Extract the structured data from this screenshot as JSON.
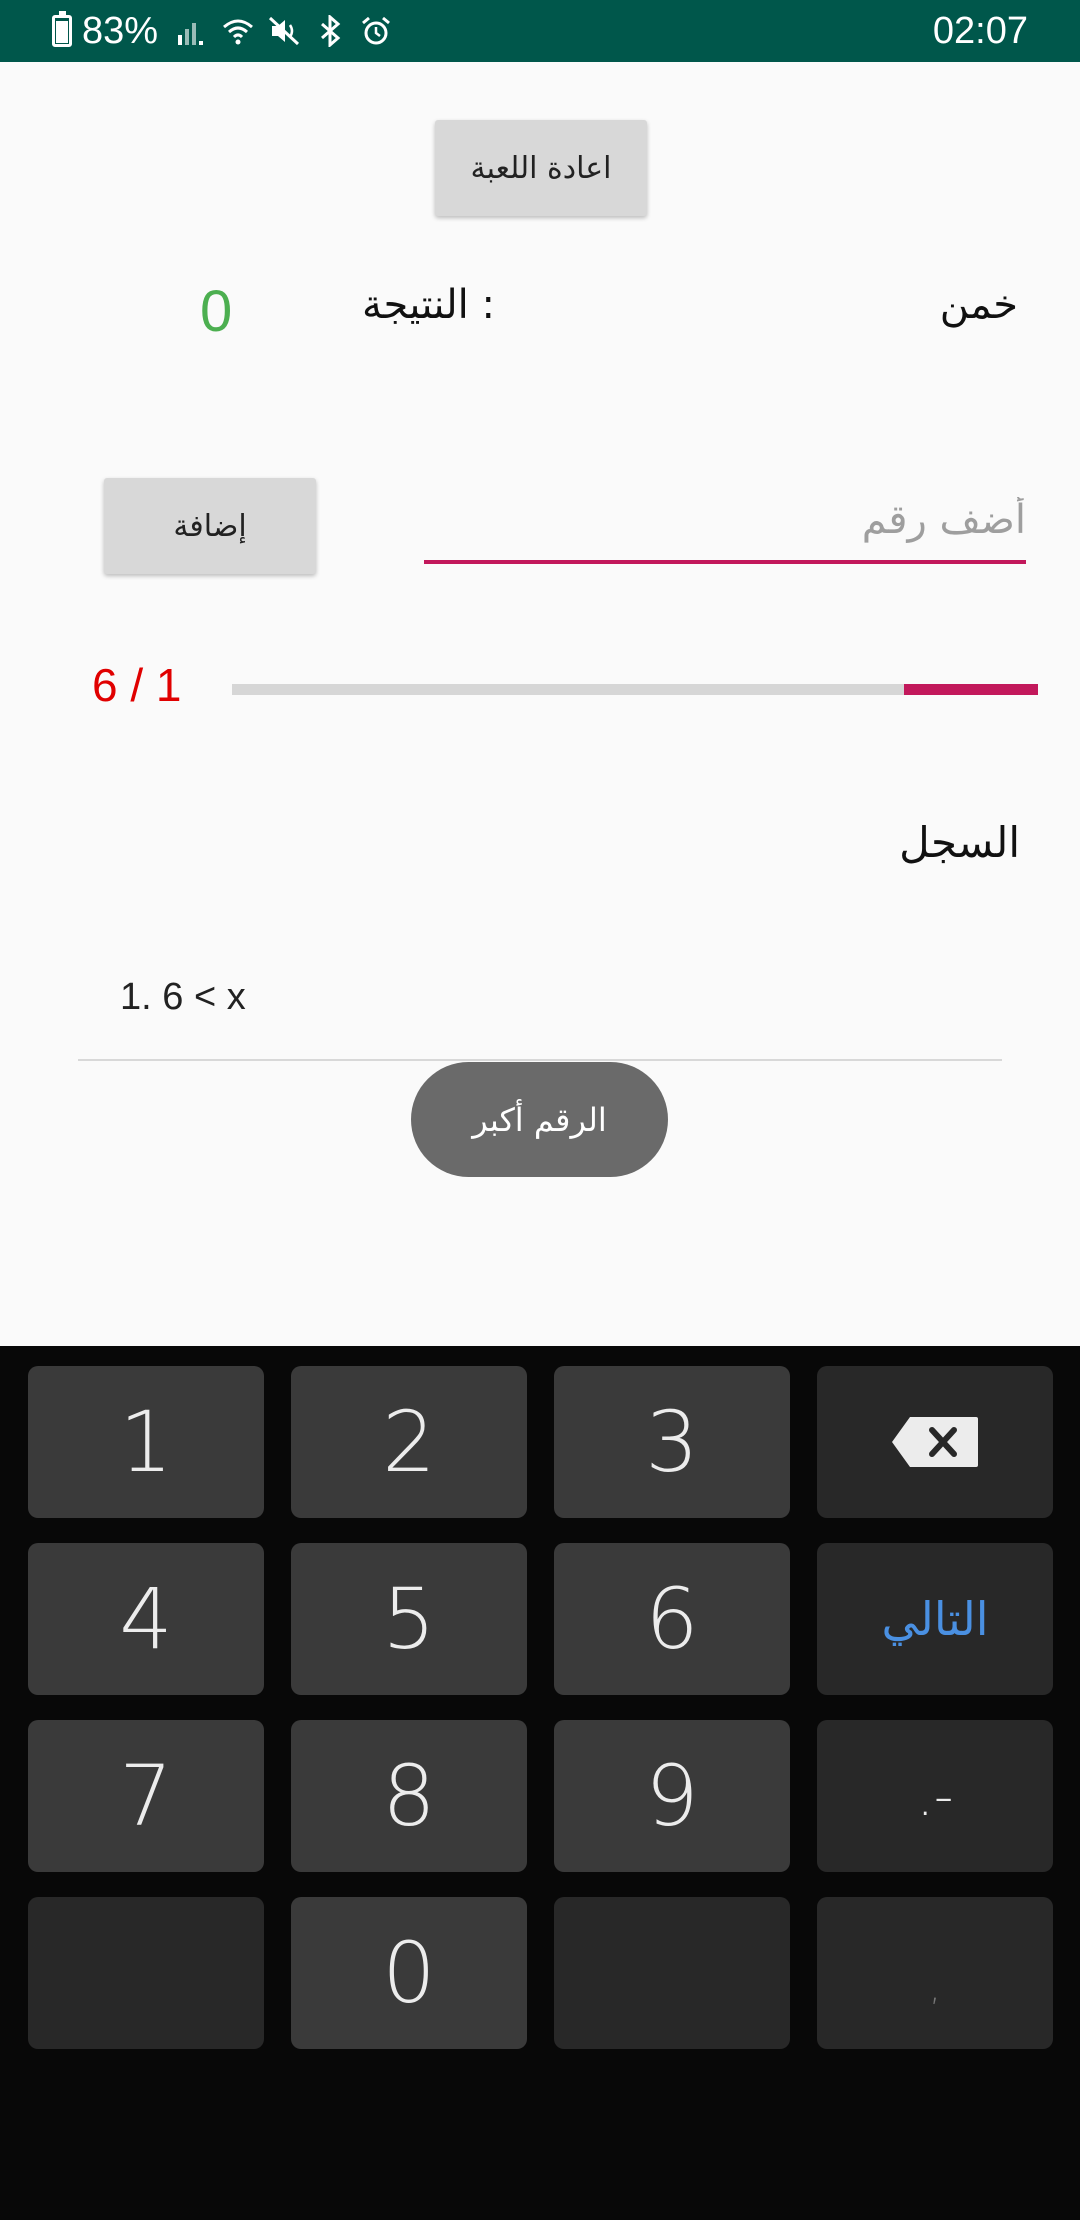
{
  "status_bar": {
    "battery_percent": "83%",
    "time": "02:07",
    "icons": [
      "battery-icon",
      "signal-icon",
      "wifi-icon",
      "mute-icon",
      "bluetooth-icon",
      "alarm-icon"
    ]
  },
  "game": {
    "restart_label": "اعادة اللعبة",
    "guess_label": "خمن",
    "score_label": ": النتيجة",
    "score_value": "0",
    "input_placeholder": "أضف رقم",
    "input_value": "",
    "add_label": "إضافة",
    "attempt_counter": "6 / 1",
    "progress_fraction": 0.1667,
    "history_title": "السجل",
    "history": [
      "1. 6 < x"
    ],
    "toast": "الرقم أكبر"
  },
  "keyboard": {
    "keys": [
      "1",
      "2",
      "3",
      "4",
      "5",
      "6",
      "7",
      "8",
      "9",
      "0"
    ],
    "next_label": "التالي",
    "minus_label": ".-",
    "comma_label": ","
  },
  "colors": {
    "status_bar": "#00574b",
    "accent": "#c2185b",
    "score": "#4caf50",
    "counter": "#e00000",
    "next_key": "#4a90e2"
  }
}
